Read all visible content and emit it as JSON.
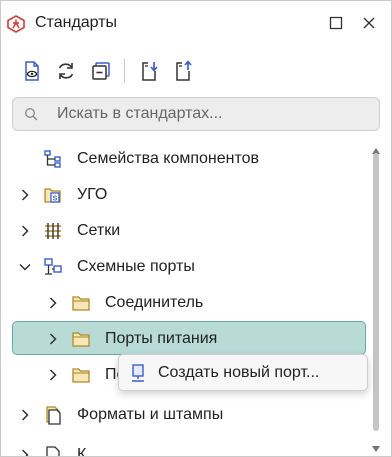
{
  "window": {
    "title": "Стандарты",
    "buttons": [
      "maximize-icon",
      "close-icon"
    ]
  },
  "toolbar": {
    "buttons": [
      "document-preview-icon",
      "refresh-icon",
      "collapse-all-icon",
      "import-icon",
      "export-icon"
    ]
  },
  "search": {
    "placeholder": "Искать в стандартах...",
    "value": ""
  },
  "tree": {
    "items": [
      {
        "label": "Семейства компонентов",
        "level": 0,
        "expandable": false,
        "icon": "hierarchy-icon"
      },
      {
        "label": "УГО",
        "level": 0,
        "expandable": true,
        "expanded": false,
        "icon": "symbol-folder-icon"
      },
      {
        "label": "Сетки",
        "level": 0,
        "expandable": true,
        "expanded": false,
        "icon": "grid-icon"
      },
      {
        "label": "Схемные порты",
        "level": 0,
        "expandable": true,
        "expanded": true,
        "icon": "network-ports-icon"
      },
      {
        "label": "Соединитель",
        "level": 1,
        "expandable": true,
        "expanded": false,
        "icon": "folder-icon"
      },
      {
        "label": "Порты питания",
        "level": 1,
        "expandable": true,
        "expanded": false,
        "icon": "folder-icon",
        "selected": true
      },
      {
        "label": "По",
        "level": 1,
        "expandable": true,
        "expanded": false,
        "icon": "folder-icon"
      },
      {
        "label": "Форматы и штампы",
        "level": 0,
        "expandable": true,
        "expanded": false,
        "icon": "document-stack-icon"
      },
      {
        "label": "К",
        "level": 0,
        "expandable": true,
        "expanded": false,
        "icon": "document-icon"
      }
    ]
  },
  "context_menu": {
    "items": [
      {
        "label": "Создать новый порт...",
        "icon": "port-icon"
      }
    ]
  },
  "colors": {
    "accent": "#3d5ec9",
    "selection_bg": "#b9dbd6",
    "selection_border": "#6eaaa0",
    "folder": "#c9a44a",
    "app_logo": "#d23b3b"
  }
}
